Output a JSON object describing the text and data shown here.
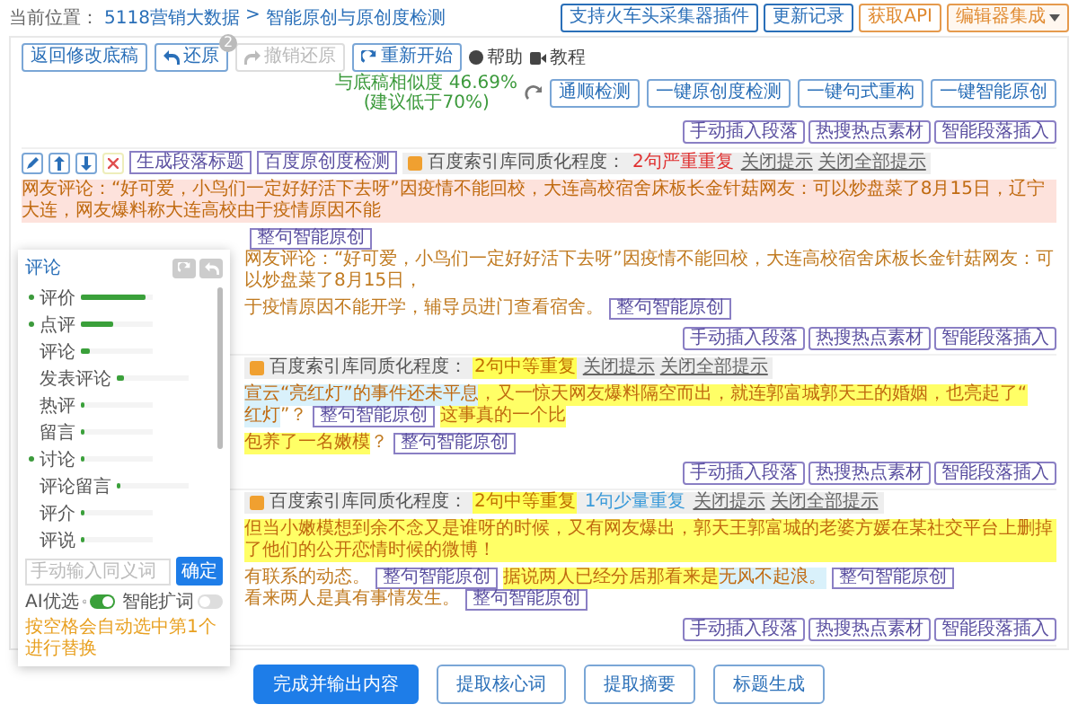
{
  "breadcrumb": {
    "label": "当前位置：",
    "items": [
      "5118营销大数据",
      "智能原创与原创度检测"
    ],
    "separator": ">"
  },
  "top_buttons": [
    {
      "label": "支持火车头采集器插件",
      "kind": "outline"
    },
    {
      "label": "更新记录",
      "kind": "outline"
    },
    {
      "label": "获取API",
      "kind": "accent"
    },
    {
      "label": "编辑器集成",
      "kind": "dropdown"
    }
  ],
  "toolbar": {
    "back": "返回修改底稿",
    "restore": {
      "label": "还原",
      "badge": "2"
    },
    "undo_restore": {
      "label": "撤销还原",
      "disabled": true
    },
    "restart": "重新开始",
    "help": "帮助",
    "tutorial": "教程",
    "similarity": {
      "text": "与底稿相似度 46.69%",
      "hint": "(建议低于70%)"
    },
    "actions": [
      "通顺检测",
      "一键原创度检测",
      "一键句式重构",
      "一键智能原创"
    ]
  },
  "blocks": [
    {
      "insert_bar": [
        "手动插入段落",
        "热搜热点素材",
        "智能段落插入"
      ],
      "tools": [
        {
          "kind": "edit"
        },
        {
          "kind": "up"
        },
        {
          "kind": "down"
        },
        {
          "kind": "delete"
        }
      ],
      "tool_buttons": [
        "生成段落标题",
        "百度原创度检测"
      ],
      "hint_label": "百度索引库同质化程度：",
      "hints": [
        {
          "text": "2句严重重复",
          "kind": "severe"
        }
      ],
      "close": "关闭提示",
      "close_all": "关闭全部提示",
      "lines": [
        {
          "segments": [
            {
              "kind": "text",
              "color": "#fde2dc",
              "text": "网友评论：“好可爱，小鸟们一定好好活下去呀”因疫情不能回校，大连高校宿舍床板长金针菇网友：可以炒盘菜了8月15日，辽宁大连，网友爆料称大连高校由于疫情原因不能"
            }
          ]
        },
        {
          "segments": [
            {
              "kind": "button",
              "text": "整句智能原创"
            },
            {
              "kind": "text",
              "text": "网友评论：“好可爱，小鸟们一定好好活下去呀”因疫情不能回校，大连高校宿舍床板长金针菇网友：可以炒盘菜了8月15日，"
            }
          ]
        },
        {
          "segments": [
            {
              "kind": "text",
              "text": "于疫情原因不能开学，辅导员进门查看宿舍。"
            },
            {
              "kind": "button",
              "text": "整句智能原创"
            }
          ]
        }
      ]
    },
    {
      "insert_bar": [
        "手动插入段落",
        "热搜热点素材",
        "智能段落插入"
      ],
      "hint_label": "百度索引库同质化程度：",
      "hints": [
        {
          "text": "2句中等重复",
          "kind": "medium"
        }
      ],
      "close": "关闭提示",
      "close_all": "关闭全部提示",
      "lines": [
        {
          "segments": [
            {
              "kind": "text",
              "color": "#d9f1fb",
              "text": "宣云“亮红灯”的事件还未平息"
            },
            {
              "kind": "text",
              "color": "#ffff66",
              "text": "，又一惊天网友爆料隔空而出，就连郭富城郭天王的婚姻，也亮起了“"
            },
            {
              "kind": "text",
              "color": "#d9f1fb",
              "text": "红灯"
            },
            {
              "kind": "text",
              "text": "”？"
            },
            {
              "kind": "button",
              "text": "整句智能原创"
            },
            {
              "kind": "text",
              "color": "#ffff66",
              "text": "这事真的一个比"
            }
          ]
        },
        {
          "segments": [
            {
              "kind": "text",
              "color": "#ffff66",
              "text": "包养了一名嫩模"
            },
            {
              "kind": "text",
              "text": "？"
            },
            {
              "kind": "button",
              "text": "整句智能原创"
            }
          ]
        }
      ]
    },
    {
      "insert_bar": [
        "手动插入段落",
        "热搜热点素材",
        "智能段落插入"
      ],
      "hint_label": "百度索引库同质化程度：",
      "hints": [
        {
          "text": "2句中等重复",
          "kind": "medium"
        },
        {
          "text": "1句少量重复",
          "kind": "light"
        }
      ],
      "close": "关闭提示",
      "close_all": "关闭全部提示",
      "lines": [
        {
          "segments": [
            {
              "kind": "text",
              "color": "#ffff66",
              "text": "但当小嫩模想到余不念又是谁呀的时候，又有网友爆出，郭天王郭富城的老婆方媛在某社交平台上删掉了他们的公开恋情时候的微博！"
            }
          ]
        },
        {
          "segments": [
            {
              "kind": "text",
              "text": "有联系的动态。"
            },
            {
              "kind": "button",
              "text": "整句智能原创"
            },
            {
              "kind": "text",
              "color": "#ffff66",
              "text": "据说两人已经分居那看来是"
            },
            {
              "kind": "text",
              "color": "#d9f1fb",
              "text": "无风不起浪。"
            },
            {
              "kind": "button",
              "text": "整句智能原创"
            },
            {
              "kind": "text",
              "text": "看来两人是真有事情发生。"
            },
            {
              "kind": "button",
              "text": "整句智能原创"
            }
          ]
        }
      ]
    }
  ],
  "final_insert_bar": [
    "手动插入段落",
    "热搜热点素材",
    "智能段落插入"
  ],
  "popup": {
    "title": "评论",
    "items": [
      {
        "label": "评价",
        "marked": true,
        "level": 0.9
      },
      {
        "label": "点评",
        "marked": true,
        "level": 0.45
      },
      {
        "label": "评论",
        "marked": false,
        "level": 0.12
      },
      {
        "label": "发表评论",
        "marked": false,
        "level": 0.1
      },
      {
        "label": "热评",
        "marked": false,
        "level": 0.06
      },
      {
        "label": "留言",
        "marked": false,
        "level": 0.06
      },
      {
        "label": "讨论",
        "marked": true,
        "level": 0.06
      },
      {
        "label": "评论留言",
        "marked": false,
        "level": 0.05
      },
      {
        "label": "评介",
        "marked": false,
        "level": 0.04
      },
      {
        "label": "评说",
        "marked": false,
        "level": 0.04
      }
    ],
    "placeholder": "手动输入同义词",
    "confirm": "确定",
    "ai_label": "AI优选",
    "ai_on": true,
    "expand_label": "智能扩词",
    "expand_on": false,
    "note": "按空格会自动选中第1个进行替换"
  },
  "bottom_buttons": [
    {
      "label": "完成并输出内容",
      "primary": true
    },
    {
      "label": "提取核心词",
      "primary": false
    },
    {
      "label": "提取摘要",
      "primary": false
    },
    {
      "label": "标题生成",
      "primary": false
    }
  ]
}
